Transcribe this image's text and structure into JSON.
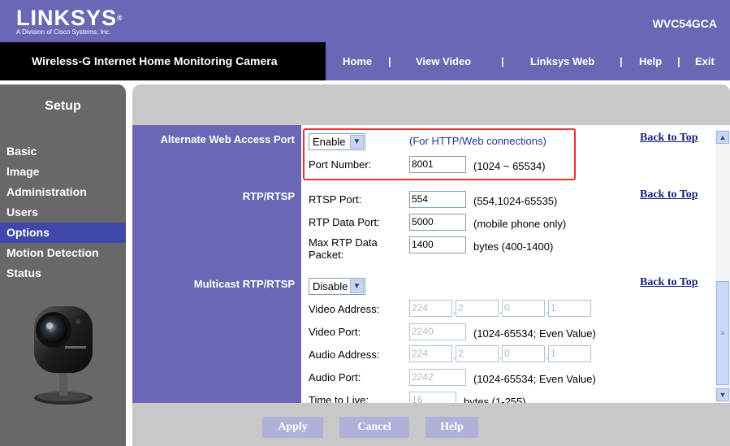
{
  "header": {
    "brand": "LINKSYS",
    "registered_mark": "®",
    "brand_sub": "A Division of Cisco Systems, Inc.",
    "model": "WVC54GCA"
  },
  "navbar": {
    "product_name": "Wireless-G Internet Home Monitoring Camera",
    "links": [
      "Home",
      "View Video",
      "Linksys Web",
      "Help",
      "Exit"
    ],
    "separator": "|"
  },
  "sidebar": {
    "title": "Setup",
    "items": [
      "Basic",
      "Image",
      "Administration",
      "Users",
      "Options",
      "Motion Detection",
      "Status"
    ],
    "active_index": 4,
    "camera_image": "camera-icon"
  },
  "alternate_web": {
    "label": "Alternate Web Access Port",
    "state": "Enable",
    "note": "(For HTTP/Web connections)",
    "port_label": "Port Number:",
    "port_value": "8001",
    "port_range": "(1024 ~ 65534)"
  },
  "rtp_rtsp": {
    "label": "RTP/RTSP",
    "rtsp_port_label": "RTSP Port:",
    "rtsp_port_value": "554",
    "rtsp_port_hint": "(554,1024-65535)",
    "rtp_data_port_label": "RTP Data Port:",
    "rtp_data_port_value": "5000",
    "rtp_data_port_hint": "(mobile phone only)",
    "max_packet_label_1": "Max RTP Data",
    "max_packet_label_2": "Packet:",
    "max_packet_value": "1400",
    "max_packet_hint": "bytes (400-1400)"
  },
  "multicast": {
    "label": "Multicast RTP/RTSP",
    "state": "Disable",
    "video_address_label": "Video Address:",
    "video_address": [
      "224",
      "2",
      "0",
      "1"
    ],
    "video_port_label": "Video Port:",
    "video_port_value": "2240",
    "video_port_hint": "(1024-65534; Even Value)",
    "audio_address_label": "Audio Address:",
    "audio_address": [
      "224",
      "2",
      "0",
      "1"
    ],
    "audio_port_label": "Audio Port:",
    "audio_port_value": "2242",
    "audio_port_hint": "(1024-65534; Even Value)",
    "ttl_label": "Time to Live:",
    "ttl_value": "16",
    "ttl_hint": "bytes (1-255)"
  },
  "back_to_top": "Back to Top",
  "buttons": {
    "apply": "Apply",
    "cancel": "Cancel",
    "help": "Help"
  },
  "colors": {
    "brand_purple": "#6a68b4",
    "active_menu": "#3f48a8",
    "highlight_red": "#e2342c",
    "link_blue": "#1a2278"
  }
}
